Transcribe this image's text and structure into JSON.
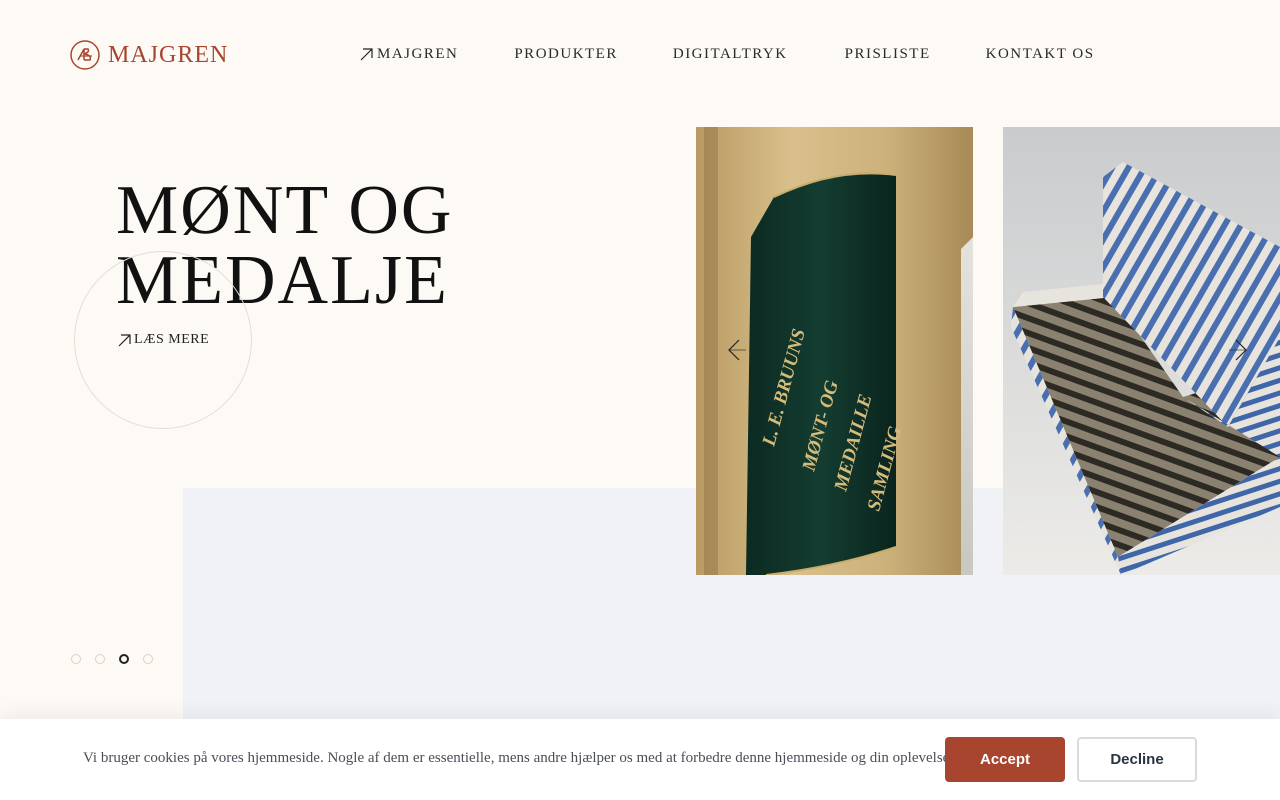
{
  "brand": {
    "name": "MAJGREN",
    "accent": "#a8452f"
  },
  "nav": {
    "items": [
      {
        "label": "MAJGREN",
        "icon": "arrow-up-right-icon"
      },
      {
        "label": "PRODUKTER"
      },
      {
        "label": "DIGITALTRYK"
      },
      {
        "label": "PRISLISTE"
      },
      {
        "label": "KONTAKT OS"
      }
    ]
  },
  "hero": {
    "title_line1": "MØNT OG",
    "title_line2": "MEDALJE",
    "cta_label": "LÆS MERE",
    "cta_icon": "arrow-up-right-icon"
  },
  "slider": {
    "prev_icon": "chevron-left-icon",
    "next_icon": "chevron-right-icon",
    "slides": [
      {
        "spine_lines": [
          "L. E. BRUUNS",
          "MØNT- OG",
          "MEDAILLE",
          "SAMLING"
        ]
      },
      {
        "subject": "striped-box"
      }
    ],
    "dots_count": 4,
    "active_dot": 3
  },
  "cookie": {
    "message": "Vi bruger cookies på vores hjemmeside. Nogle af dem er essentielle, mens andre hjælper os med at forbedre denne hjemmeside og din oplevelse.",
    "accept_label": "Accept",
    "decline_label": "Decline"
  }
}
